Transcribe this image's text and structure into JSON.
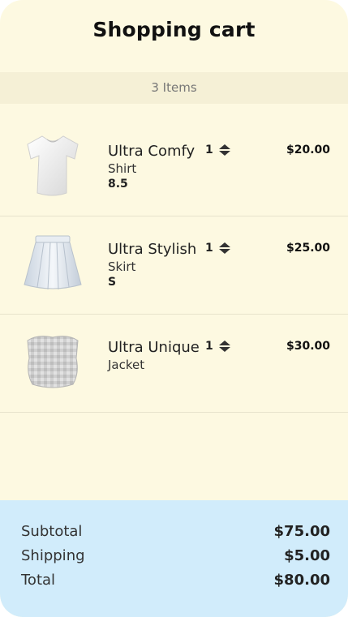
{
  "header": {
    "title": "Shopping cart"
  },
  "cart": {
    "count_label": "3 Items"
  },
  "items": [
    {
      "name": "Ultra Comfy",
      "category": "Shirt",
      "size": "8.5",
      "quantity": "1",
      "price": "$20.00",
      "image_icon": "shirt-icon"
    },
    {
      "name": "Ultra Stylish",
      "category": "Skirt",
      "size": "S",
      "quantity": "1",
      "price": "$25.00",
      "image_icon": "skirt-icon"
    },
    {
      "name": "Ultra Unique",
      "category": "Jacket",
      "size": "",
      "quantity": "1",
      "price": "$30.00",
      "image_icon": "jacket-icon"
    }
  ],
  "summary": {
    "subtotal_label": "Subtotal",
    "subtotal_value": "$75.00",
    "shipping_label": "Shipping",
    "shipping_value": "$5.00",
    "total_label": "Total",
    "total_value": "$80.00"
  },
  "colors": {
    "card_background": "#fdf9e1",
    "summary_background": "#d1ecfb"
  }
}
